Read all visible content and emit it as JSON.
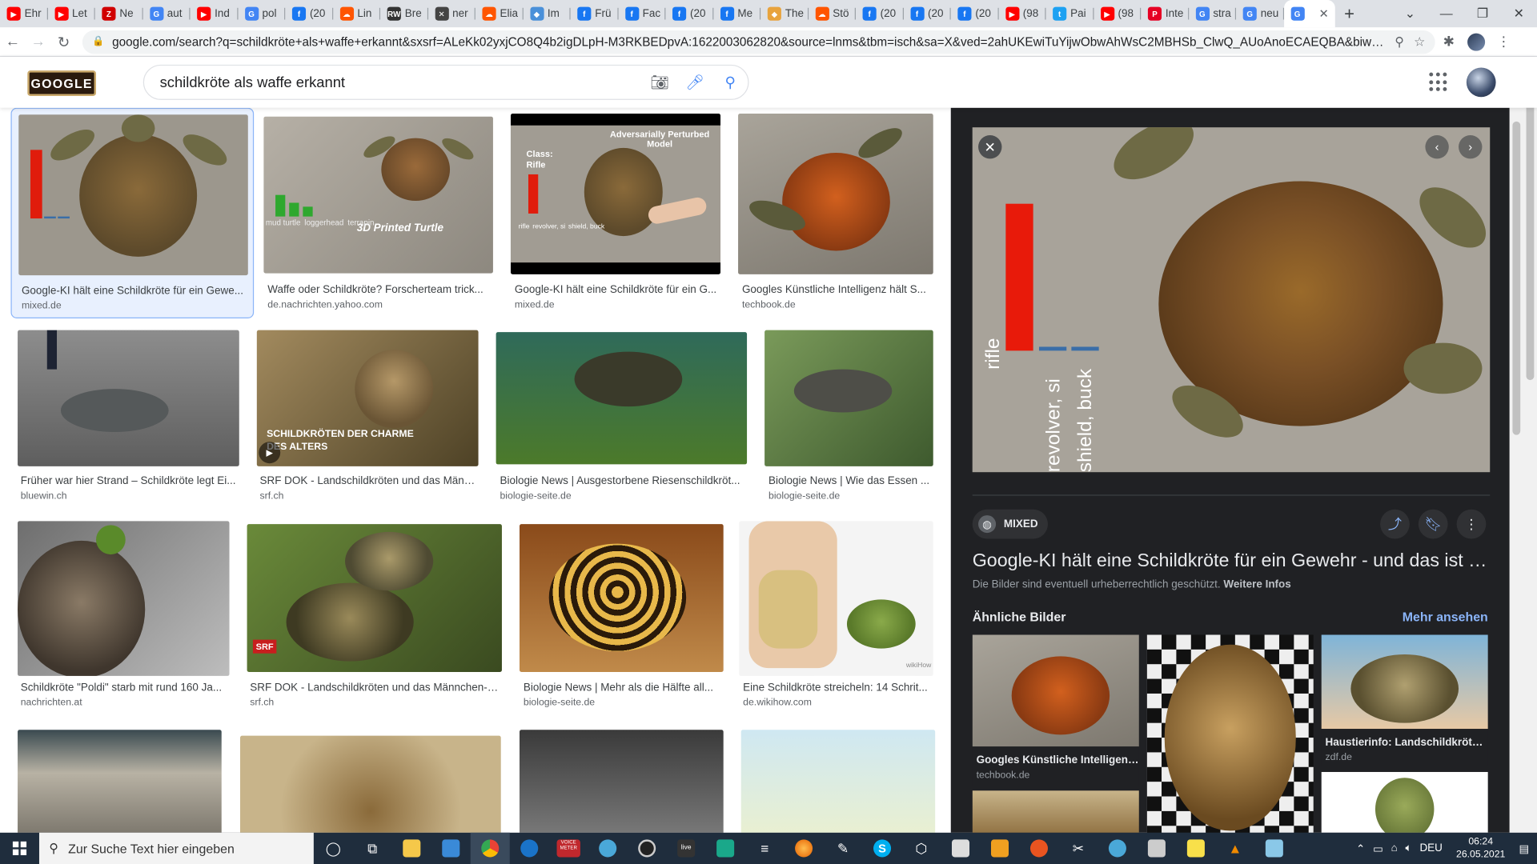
{
  "browser": {
    "tabs": [
      {
        "label": "Ehr",
        "icon": "youtube-icon",
        "color": "#ff0000"
      },
      {
        "label": "Let",
        "icon": "youtube-icon",
        "color": "#ff0000"
      },
      {
        "label": "Ne",
        "icon": "zeit-icon",
        "color": "#d00000"
      },
      {
        "label": "aut",
        "icon": "google-icon",
        "color": "#4285f4"
      },
      {
        "label": "Ind",
        "icon": "youtube-icon",
        "color": "#ff0000"
      },
      {
        "label": "pol",
        "icon": "google-icon",
        "color": "#4285f4"
      },
      {
        "label": "(20",
        "icon": "facebook-icon",
        "color": "#1877f2"
      },
      {
        "label": "Lin",
        "icon": "soundcloud-icon",
        "color": "#ff5500"
      },
      {
        "label": "Bre",
        "icon": "rw-icon",
        "color": "#333333"
      },
      {
        "label": "ner",
        "icon": "circle-x-icon",
        "color": "#444444"
      },
      {
        "label": "Elia",
        "icon": "soundcloud-icon",
        "color": "#ff5500"
      },
      {
        "label": "Im",
        "icon": "site-icon",
        "color": "#4a90d9"
      },
      {
        "label": "Frü",
        "icon": "facebook-icon",
        "color": "#1877f2"
      },
      {
        "label": "Fac",
        "icon": "facebook-icon",
        "color": "#1877f2"
      },
      {
        "label": "(20",
        "icon": "facebook-icon",
        "color": "#1877f2"
      },
      {
        "label": "Me",
        "icon": "facebook-icon",
        "color": "#1877f2"
      },
      {
        "label": "The",
        "icon": "site-icon",
        "color": "#e8a33d"
      },
      {
        "label": "Stö",
        "icon": "soundcloud-icon",
        "color": "#ff5500"
      },
      {
        "label": "(20",
        "icon": "facebook-icon",
        "color": "#1877f2"
      },
      {
        "label": "(20",
        "icon": "facebook-icon",
        "color": "#1877f2"
      },
      {
        "label": "(20",
        "icon": "facebook-icon",
        "color": "#1877f2"
      },
      {
        "label": "(98",
        "icon": "youtube-icon",
        "color": "#ff0000"
      },
      {
        "label": "Pai",
        "icon": "twitter-icon",
        "color": "#1da1f2"
      },
      {
        "label": "(98",
        "icon": "youtube-icon",
        "color": "#ff0000"
      },
      {
        "label": "Inte",
        "icon": "pinterest-icon",
        "color": "#e60023"
      },
      {
        "label": "stra",
        "icon": "google-icon",
        "color": "#4285f4"
      },
      {
        "label": "neu",
        "icon": "google-icon",
        "color": "#4285f4"
      }
    ],
    "active_tab_icon": "google-icon",
    "new_tab": "+",
    "url": "google.com/search?q=schildkröte+als+waffe+erkannt&sxsrf=ALeKk02yxjCO8Q4b2igDLpH-M3RKBEDpvA:1622003062820&source=lnms&tbm=isch&sa=X&ved=2ahUKEwiTuYijwObwAhWsC2MBHSb_ClwQ_AUoAnoECAEQBA&biw=1745&bih=881#imgrc=-z..."
  },
  "google": {
    "logo": "GOOGLE",
    "query": "schildkröte als waffe erkannt"
  },
  "results": [
    {
      "title": "Google-KI hält eine Schildkröte für ein Gewe...",
      "source": "mixed.de"
    },
    {
      "title": "Waffe oder Schildkröte? Forscherteam trick...",
      "source": "de.nachrichten.yahoo.com",
      "overlay": "3D Printed Turtle",
      "bar_labels": [
        "mud turtle",
        "loggerhead",
        "terrapin"
      ]
    },
    {
      "title": "Google-KI hält eine Schildkröte für ein G...",
      "source": "mixed.de",
      "overlay": "Adversarially Perturbed Model",
      "class_label": "Class: Rifle",
      "bar_labels": [
        "rifle",
        "revolver, si",
        "shield, buck"
      ]
    },
    {
      "title": "Googles Künstliche Intelligenz hält S...",
      "source": "techbook.de"
    },
    {
      "title": "Früher war hier Strand – Schildkröte legt Ei...",
      "source": "bluewin.ch"
    },
    {
      "title": "SRF DOK - Landschildkröten und das Männ...",
      "source": "srf.ch",
      "overlay": "SCHILDKRÖTEN DER CHARME DES ALTERS"
    },
    {
      "title": "Biologie News | Ausgestorbene Riesenschildkröt...",
      "source": "biologie-seite.de"
    },
    {
      "title": "Biologie News | Wie das Essen ...",
      "source": "biologie-seite.de"
    },
    {
      "title": "Schildkröte \"Poldi\" starb mit rund 160 Ja...",
      "source": "nachrichten.at"
    },
    {
      "title": "SRF DOK - Landschildkröten und das Männchen-D...",
      "source": "srf.ch",
      "overlay": "SRF"
    },
    {
      "title": "Biologie News | Mehr als die Hälfte all...",
      "source": "biologie-seite.de"
    },
    {
      "title": "Eine Schildkröte streicheln: 14 Schrit...",
      "source": "de.wikihow.com",
      "overlay": "wikiHow"
    }
  ],
  "panel": {
    "source": "MIXED",
    "title": "Google-KI hält eine Schildkröte für ein Gewehr - und das ist ein P...",
    "copyright": "Die Bilder sind eventuell urheberrechtlich geschützt.",
    "copyright_link": "Weitere Infos",
    "similar_heading": "Ähnliche Bilder",
    "more_link": "Mehr ansehen",
    "image_labels": [
      "rifle",
      "revolver, si",
      "shield, buck"
    ],
    "similar": [
      {
        "title": "Googles Künstliche Intelligenz ...",
        "source": "techbook.de"
      },
      {
        "title": "Haustierinfo: Landschildkröten ...",
        "source": "zdf.de"
      }
    ]
  },
  "taskbar": {
    "search_placeholder": "Zur Suche Text hier eingeben",
    "lang": "DEU",
    "time": "06:24",
    "date": "26.05.2021",
    "voice_meeter": "VOICE METER",
    "live": "live"
  }
}
